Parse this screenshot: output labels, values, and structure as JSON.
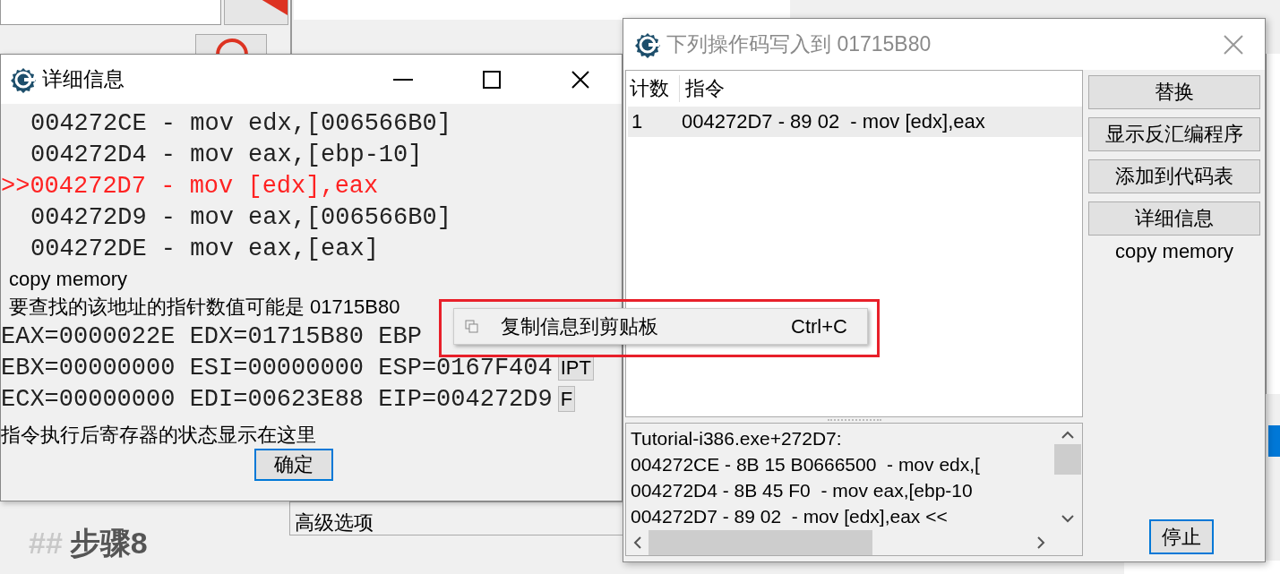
{
  "background": {
    "panel_label": "高级选项",
    "heading_marker": "##",
    "heading": "步骤8"
  },
  "details_window": {
    "title": "详细信息",
    "current_marker": ">>",
    "code_lines": [
      {
        "text": "004272CE - mov edx,[006566B0]",
        "current": false
      },
      {
        "text": "004272D4 - mov eax,[ebp-10]",
        "current": false
      },
      {
        "text": "004272D7 - mov [edx],eax",
        "current": true
      },
      {
        "text": "004272D9 - mov eax,[006566B0]",
        "current": false
      },
      {
        "text": "004272DE - mov eax,[eax]",
        "current": false
      }
    ],
    "comment": "copy memory",
    "pointer_note": "要查找的该地址的指针数值可能是 01715B80",
    "registers": [
      {
        "text": "EAX=0000022E EDX=01715B80 EBP"
      },
      {
        "text": "EBX=00000000 ESI=00000000 ESP=0167F404",
        "button": "IPT"
      },
      {
        "text": "ECX=00000000 EDI=00623E88 EIP=004272D9",
        "button": "F"
      }
    ],
    "status": "指令执行后寄存器的状态显示在这里",
    "ok_button": "确定"
  },
  "opcode_window": {
    "title": "下列操作码写入到 01715B80",
    "columns": [
      "计数",
      "指令"
    ],
    "rows": [
      {
        "count": "1",
        "instruction": "004272D7 - 89 02  - mov [edx],eax",
        "selected": true
      }
    ],
    "buttons": [
      "替换",
      "显示反汇编程序",
      "添加到代码表",
      "详细信息"
    ],
    "comment": "copy memory",
    "memo_lines": [
      "Tutorial-i386.exe+272D7:",
      "004272CE - 8B 15 B0666500  - mov edx,[",
      "004272D4 - 8B 45 F0  - mov eax,[ebp-10",
      "004272D7 - 89 02  - mov [edx],eax <<"
    ],
    "stop_button": "停止"
  },
  "context_menu": {
    "items": [
      {
        "label": "复制信息到剪贴板",
        "shortcut": "Ctrl+C"
      }
    ]
  }
}
